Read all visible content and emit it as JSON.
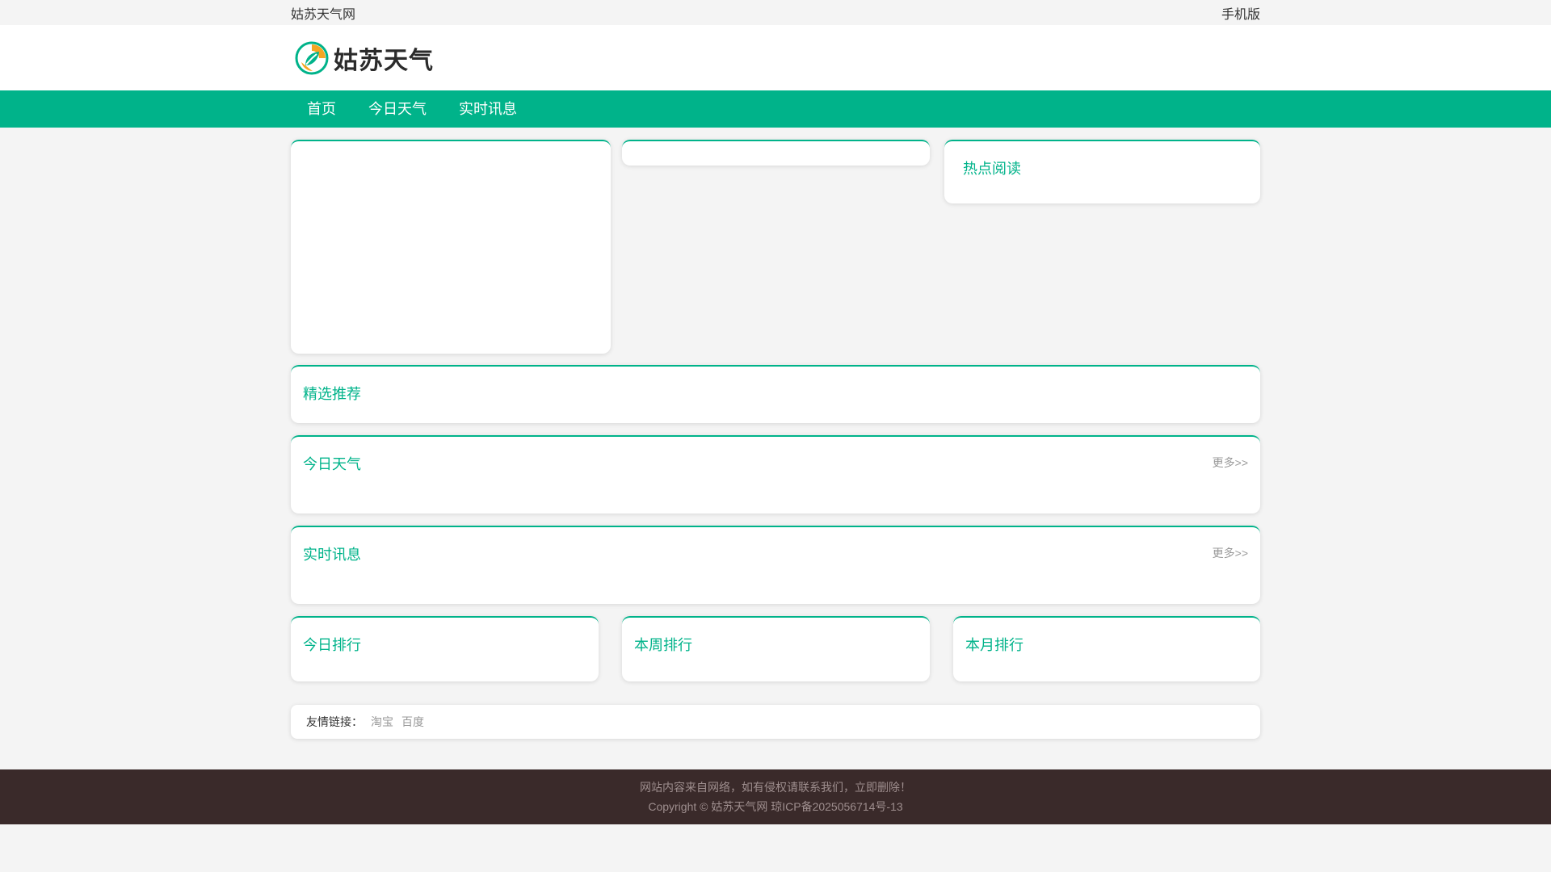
{
  "topbar": {
    "site_name": "姑苏天气网",
    "mobile": "手机版"
  },
  "logo": {
    "text": "姑苏天气"
  },
  "nav": {
    "items": [
      "首页",
      "今日天气",
      "实时讯息"
    ]
  },
  "panels": {
    "hot_title": "热点阅读",
    "featured_title": "精选推荐",
    "today_weather_title": "今日天气",
    "realtime_title": "实时讯息",
    "more_label": "更多>>",
    "rank_today": "今日排行",
    "rank_week": "本周排行",
    "rank_month": "本月排行"
  },
  "links": {
    "label": "友情链接：",
    "items": [
      "淘宝",
      "百度"
    ]
  },
  "footer": {
    "notice": "网站内容来自网络，如有侵权请联系我们，立即删除！",
    "copyright": "Copyright © 姑苏天气网 琼ICP备2025056714号-13"
  },
  "colors": {
    "accent": "#00b38a",
    "footer_bg": "#3a2a2a"
  }
}
